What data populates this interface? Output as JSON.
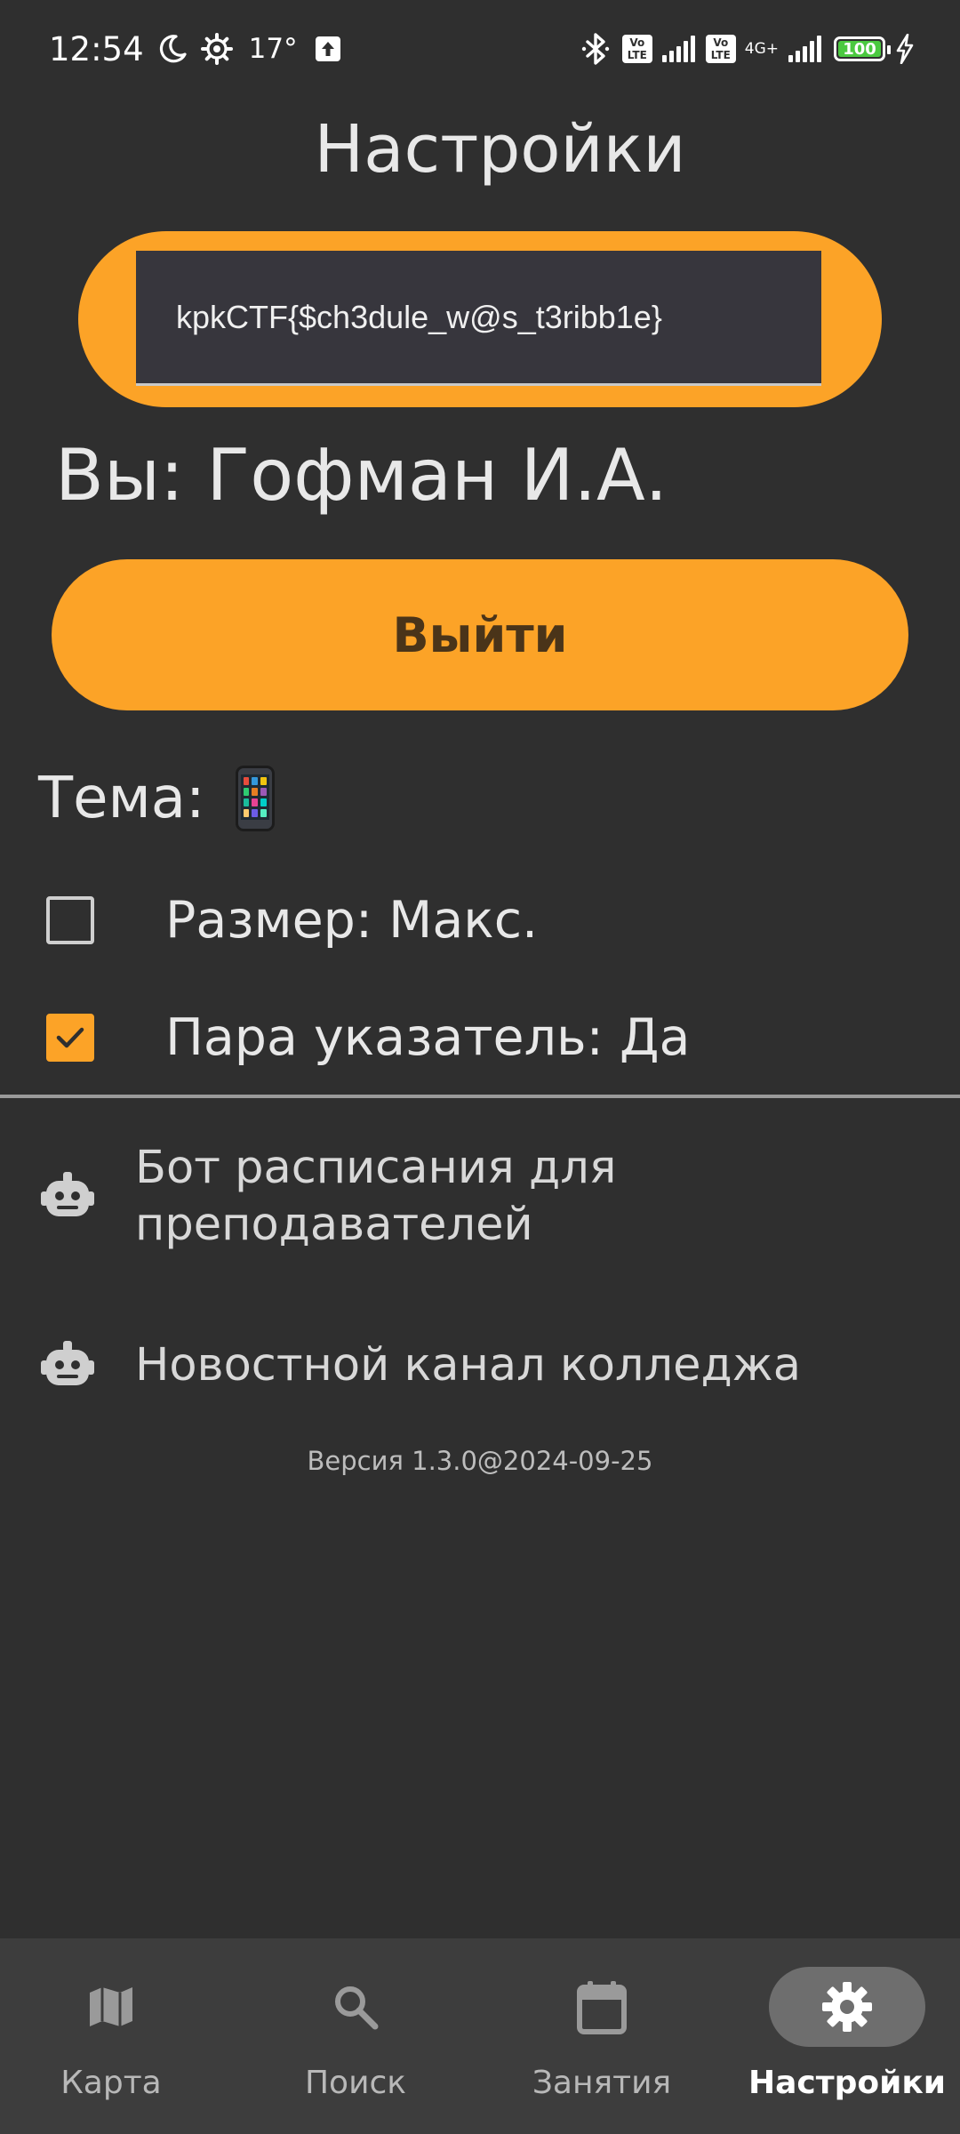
{
  "status_bar": {
    "time": "12:54",
    "temperature": "17°",
    "volte_1": "Vo LTE",
    "volte_2": "Vo LTE",
    "network": "4G+",
    "battery": "100",
    "icons": [
      "moon-icon",
      "gear-status-icon",
      "upload-icon",
      "bluetooth-icon",
      "signal-icon",
      "charging-icon"
    ]
  },
  "page": {
    "title": "Настройки"
  },
  "token": {
    "value": "kpkCTF{$ch3dule_w@s_t3ribb1e}"
  },
  "user": {
    "label": "Вы: Гофман И.А."
  },
  "logout": {
    "label": "Выйти"
  },
  "theme": {
    "label": "Тема:",
    "icon": "phone-icon"
  },
  "options": [
    {
      "label": "Размер: Макс.",
      "checked": false
    },
    {
      "label": "Пара указатель: Да",
      "checked": true
    }
  ],
  "links": [
    {
      "label": "Бот расписания для преподавателей",
      "icon": "robot-icon"
    },
    {
      "label": "Новостной канал колледжа",
      "icon": "robot-icon"
    }
  ],
  "version": "Версия 1.3.0@2024-09-25",
  "nav": [
    {
      "label": "Карта",
      "icon": "map-icon",
      "active": false
    },
    {
      "label": "Поиск",
      "icon": "search-icon",
      "active": false
    },
    {
      "label": "Занятия",
      "icon": "calendar-icon",
      "active": false
    },
    {
      "label": "Настройки",
      "icon": "settings-icon",
      "active": true
    }
  ],
  "colors": {
    "background": "#2f2f2f",
    "accent": "#fca327",
    "nav_background": "#3d3d3d",
    "nav_active_pill": "#6e6e6e",
    "battery": "#4bc940"
  }
}
